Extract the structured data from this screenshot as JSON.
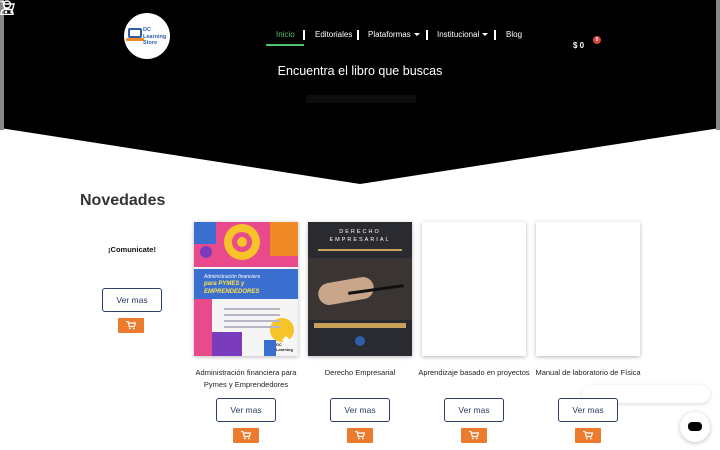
{
  "header": {
    "logo_text": "DC Learning Store",
    "nav": [
      {
        "label": "Inicio",
        "active": true
      },
      {
        "label": "Editoriales",
        "active": false
      },
      {
        "label": "Plataformas",
        "active": false,
        "dropdown": true
      },
      {
        "label": "Institucional",
        "active": false,
        "dropdown": true
      },
      {
        "label": "Blog",
        "active": false
      }
    ],
    "cart_price": "$ 0",
    "cart_count": "0",
    "hero_title": "Encuentra el libro que buscas"
  },
  "section": {
    "title": "Novedades"
  },
  "promo": {
    "text": "¡Comunicate!",
    "button_label": "Ver mas"
  },
  "books": [
    {
      "title": "Administración financiera para Pymes y Emprendedores",
      "button_label": "Ver mas",
      "cover_line1": "Administración financiera",
      "cover_line2": "para PYMES y",
      "cover_line3": "EMPRENDEDORES",
      "cover_publisher": "DC Learning"
    },
    {
      "title": "Derecho Empresarial",
      "button_label": "Ver mas",
      "cover_line1": "DERECHO",
      "cover_line2": "EMPRESARIAL"
    },
    {
      "title": "Aprendizaje basado en proyectos",
      "button_label": "Ver mas"
    },
    {
      "title": "Manual de laboratorio de Física",
      "button_label": "Ver mas"
    }
  ],
  "colors": {
    "header_bg": "#000000",
    "nav_active": "#4fc36a",
    "button_border": "#2b3e63",
    "cart_button": "#ed7b2e",
    "badge": "#e0413a"
  },
  "icons": {
    "user": "user-icon",
    "cart": "cart-icon",
    "chat": "chat-icon"
  }
}
